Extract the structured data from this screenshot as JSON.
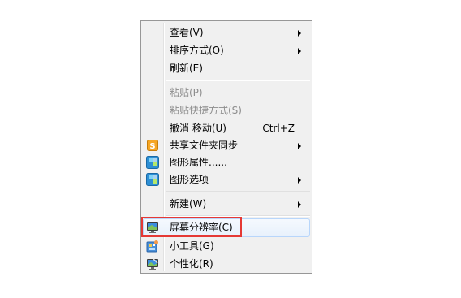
{
  "context_menu": {
    "items": [
      {
        "label": "查看(V)",
        "submenu": true
      },
      {
        "label": "排序方式(O)",
        "submenu": true
      },
      {
        "label": "刷新(E)"
      },
      {
        "label": "粘贴(P)",
        "disabled": true
      },
      {
        "label": "粘贴快捷方式(S)",
        "disabled": true
      },
      {
        "label": "撤消 移动(U)",
        "shortcut": "Ctrl+Z"
      },
      {
        "label": "共享文件夹同步",
        "submenu": true,
        "icon": "sync-folder-icon"
      },
      {
        "label": "图形属性......",
        "icon": "graphics-icon"
      },
      {
        "label": "图形选项",
        "submenu": true,
        "icon": "graphics-options-icon"
      },
      {
        "label": "新建(W)",
        "submenu": true
      },
      {
        "label": "屏幕分辨率(C)",
        "icon": "monitor-icon",
        "highlighted": true
      },
      {
        "label": "小工具(G)",
        "icon": "gadgets-icon"
      },
      {
        "label": "个性化(R)",
        "icon": "personalize-icon"
      }
    ]
  },
  "annotation": {
    "color": "#e53935"
  }
}
